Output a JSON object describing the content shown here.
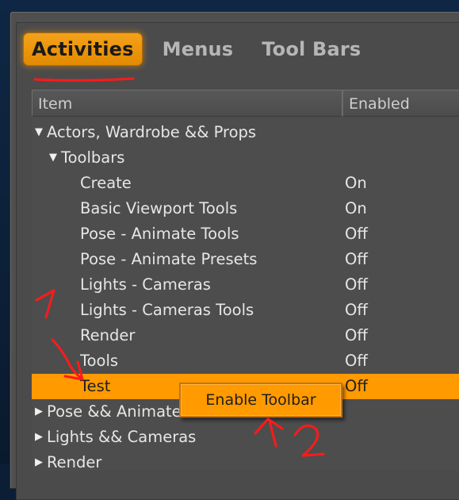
{
  "tabs": [
    {
      "label": "Activities",
      "active": true
    },
    {
      "label": "Menus",
      "active": false
    },
    {
      "label": "Tool Bars",
      "active": false
    }
  ],
  "columns": {
    "item": "Item",
    "enabled": "Enabled"
  },
  "rows": [
    {
      "label": "Actors, Wardrobe && Props",
      "value": "",
      "expanded": true,
      "arrow": "▼"
    },
    {
      "label": "Toolbars",
      "value": "",
      "expanded": true,
      "arrow": "▼"
    },
    {
      "label": "Create",
      "value": "On"
    },
    {
      "label": "Basic Viewport Tools",
      "value": "On"
    },
    {
      "label": "Pose - Animate Tools",
      "value": "Off"
    },
    {
      "label": "Pose - Animate Presets",
      "value": "Off"
    },
    {
      "label": "Lights - Cameras",
      "value": "Off"
    },
    {
      "label": "Lights - Cameras Tools",
      "value": "Off"
    },
    {
      "label": "Render",
      "value": "Off"
    },
    {
      "label": "Tools",
      "value": "Off"
    },
    {
      "label": "Test",
      "value": "Off",
      "selected": true
    },
    {
      "label": "Pose && Animate",
      "value": "",
      "expanded": false,
      "arrow": "▶"
    },
    {
      "label": "Lights && Cameras",
      "value": "",
      "expanded": false,
      "arrow": "▶"
    },
    {
      "label": "Render",
      "value": "",
      "expanded": false,
      "arrow": "▶"
    }
  ],
  "context_menu": {
    "items": [
      "Enable Toolbar"
    ]
  },
  "annotations": {
    "step1": "1",
    "step2": "2"
  },
  "colors": {
    "accent": "#ff9a00",
    "panel": "#4d4d4d",
    "annotation": "#ff1a1a"
  }
}
